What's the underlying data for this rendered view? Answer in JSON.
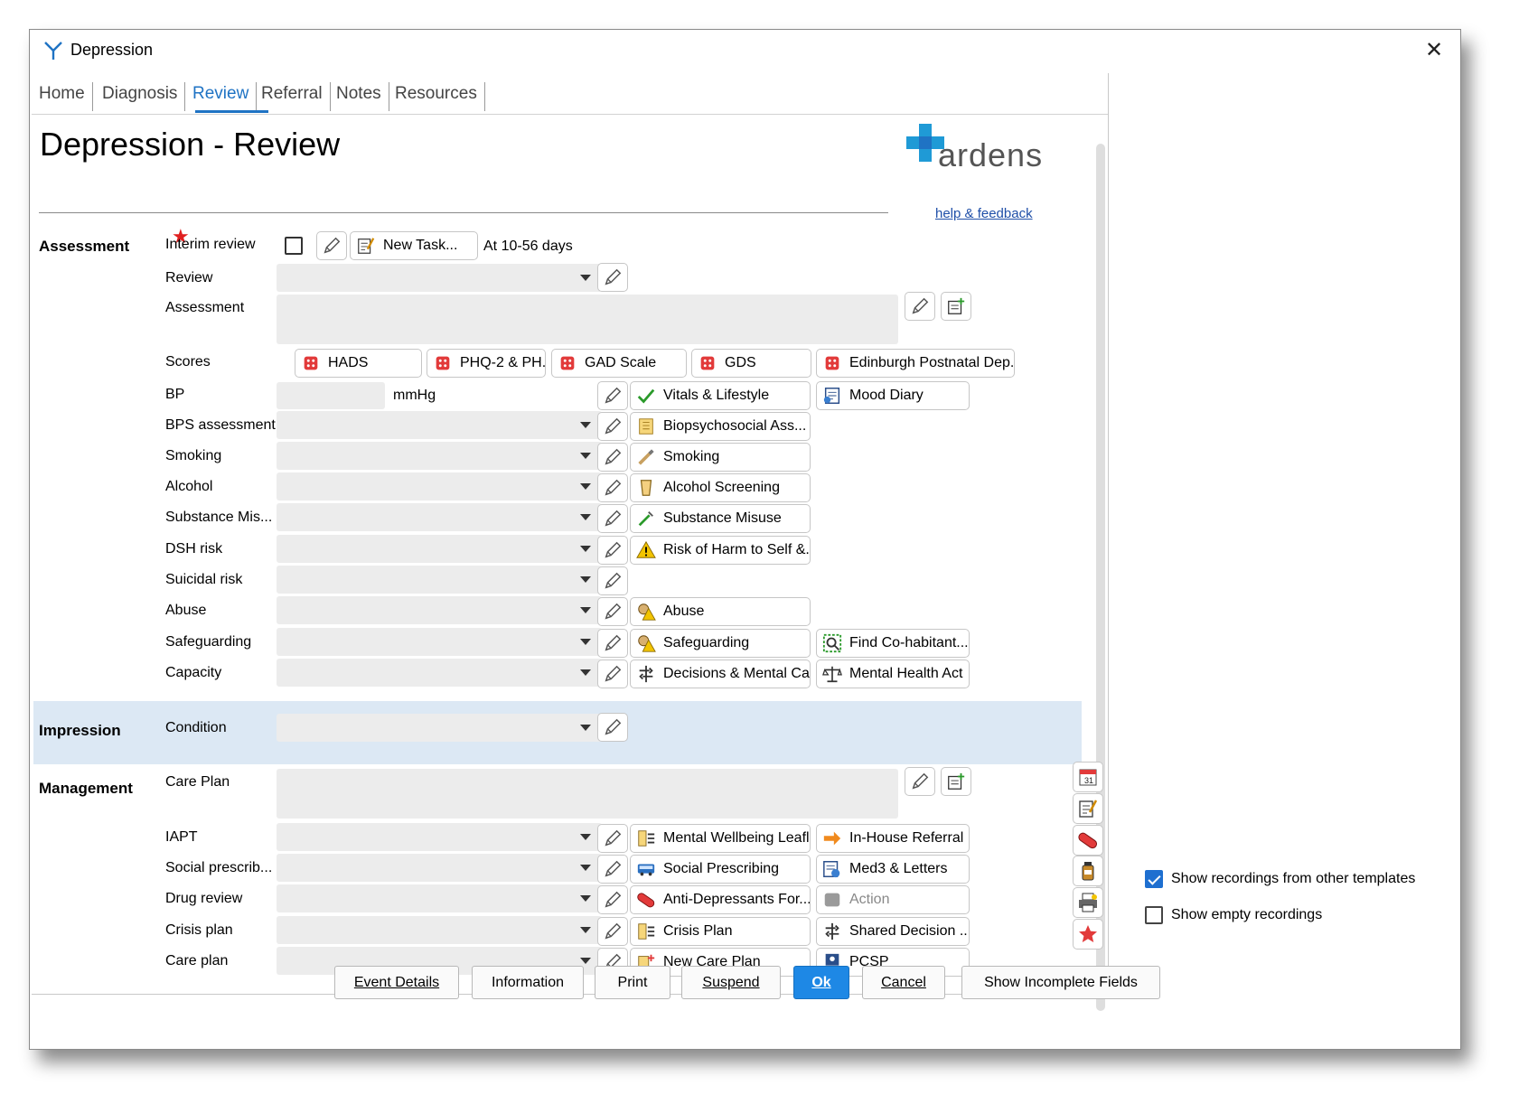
{
  "window": {
    "title": "Depression",
    "close": "✕"
  },
  "tabs": [
    {
      "label": "Home"
    },
    {
      "label": "Diagnosis"
    },
    {
      "label": "Review"
    },
    {
      "label": "Referral"
    },
    {
      "label": "Notes"
    },
    {
      "label": "Resources"
    }
  ],
  "page": {
    "title": "Depression - Review"
  },
  "logo": {
    "word": "ardens",
    "help": "help & feedback"
  },
  "sections": {
    "assessment": "Assessment",
    "impression": "Impression",
    "management": "Management"
  },
  "assessment": {
    "interim_label": "Interim review",
    "new_task": "New Task...",
    "interval": "At 10-56 days",
    "review_label": "Review",
    "assessment_label": "Assessment",
    "scores_label": "Scores",
    "scores": [
      "HADS",
      "PHQ-2 & PH...",
      "GAD Scale",
      "GDS",
      "Edinburgh Postnatal Dep..."
    ],
    "bp_label": "BP",
    "bp_unit": "mmHg",
    "vitals": "Vitals & Lifestyle",
    "mood_diary": "Mood Diary",
    "rows": [
      {
        "label": "BPS assessment",
        "button": "Biopsychosocial Ass..."
      },
      {
        "label": "Smoking",
        "button": "Smoking"
      },
      {
        "label": "Alcohol",
        "button": "Alcohol Screening"
      },
      {
        "label": "Substance Mis...",
        "button": "Substance Misuse"
      },
      {
        "label": "DSH risk",
        "button": "Risk of Harm to Self &..."
      },
      {
        "label": "Suicidal risk"
      },
      {
        "label": "Abuse",
        "button": "Abuse"
      },
      {
        "label": "Safeguarding",
        "button": "Safeguarding",
        "button2": "Find Co-habitant..."
      },
      {
        "label": "Capacity",
        "button": "Decisions & Mental Ca...",
        "button2": "Mental Health Act"
      }
    ]
  },
  "impression": {
    "condition_label": "Condition"
  },
  "management": {
    "careplan_label": "Care Plan",
    "rows": [
      {
        "label": "IAPT",
        "button": "Mental Wellbeing Leaflet",
        "button2": "In-House Referral"
      },
      {
        "label": "Social prescrib...",
        "button": "Social Prescribing",
        "button2": "Med3 & Letters"
      },
      {
        "label": "Drug review",
        "button": "Anti-Depressants For...",
        "button2": "Action"
      },
      {
        "label": "Crisis plan",
        "button": "Crisis Plan",
        "button2": "Shared Decision ..."
      },
      {
        "label": "Care plan",
        "button": "New Care Plan",
        "button2": "PCSP"
      }
    ]
  },
  "options": {
    "show_other": "Show recordings from other templates",
    "show_empty": "Show empty recordings"
  },
  "footer": {
    "event_details": "Event Details",
    "information": "Information",
    "print": "Print",
    "suspend": "Suspend",
    "ok": "Ok",
    "cancel": "Cancel",
    "incomplete": "Show Incomplete Fields"
  },
  "colors": {
    "accent": "#1f73c4",
    "ok_button": "#1e88e5",
    "required": "#e02020",
    "impression_band": "#dce8f4"
  }
}
